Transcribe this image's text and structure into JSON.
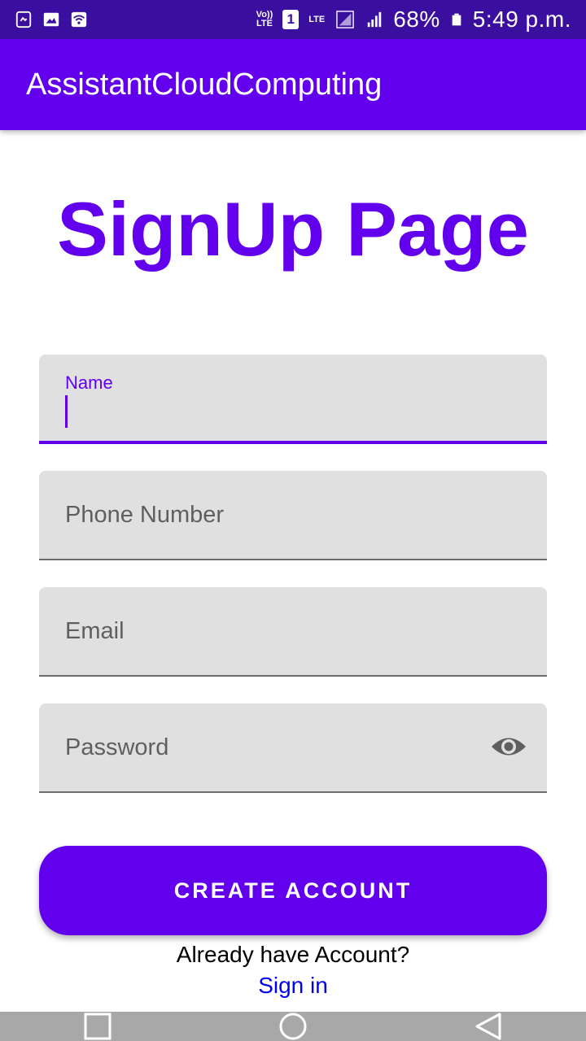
{
  "status_bar": {
    "volte_top": "Vo))",
    "volte_bottom": "LTE",
    "sim": "1",
    "lte": "LTE",
    "battery": "68%",
    "time": "5:49 p.m.",
    "icons": [
      "screenshot-icon",
      "gallery-icon",
      "wifi-icon",
      "signal-icon",
      "signal-icon",
      "battery-icon"
    ]
  },
  "app_bar": {
    "title": "AssistantCloudComputing"
  },
  "page": {
    "title": "SignUp Page"
  },
  "form": {
    "name_label": "Name",
    "name_value": "",
    "phone_placeholder": "Phone Number",
    "email_placeholder": "Email",
    "password_placeholder": "Password"
  },
  "actions": {
    "create_label": "CREATE ACCOUNT",
    "already_text": "Already have Account?",
    "signin_label": "Sign in"
  },
  "colors": {
    "primary": "#6200ee",
    "status_bar": "#3a0fa0",
    "field_bg": "#e0e0e0",
    "link": "#0000ee"
  }
}
